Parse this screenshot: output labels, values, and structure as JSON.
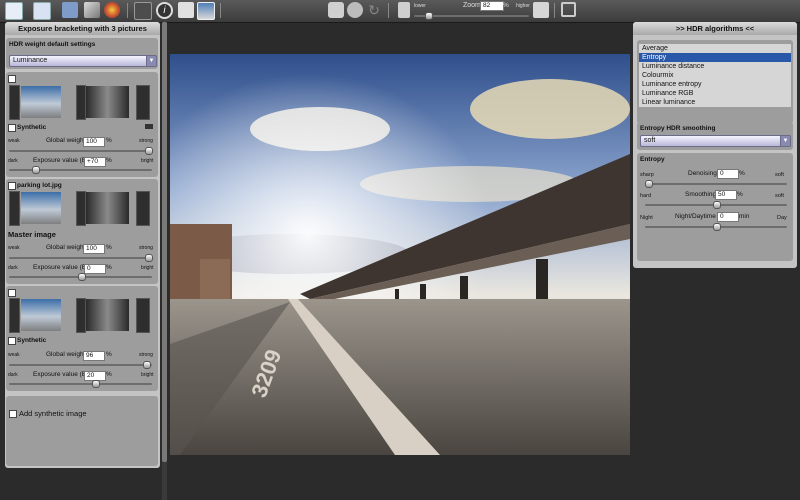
{
  "toolbar": {
    "zoom_label": "Zoom",
    "zoom_value": "82",
    "zoom_unit": "%",
    "lower_label": "lower",
    "higher_label": "higher",
    "zoom_level": 0.82
  },
  "left_panel": {
    "title": "Exposure bracketing with 3 pictures",
    "weight_default_label": "HDR weight default settings",
    "weight_mode": "Luminance",
    "images": [
      {
        "name": "Synthetic",
        "global_weight_label": "Global weight",
        "global_weight": "100",
        "percent": "%",
        "weak": "weak",
        "strong": "strong",
        "ev_label": "Exposure value (EV)",
        "ev": "+70",
        "dark": "dark",
        "bright": "bright",
        "weight_fraction": 1.0,
        "ev_fraction": 0.18
      },
      {
        "name": "parking lot.jpg",
        "master_label": "Master image",
        "global_weight_label": "Global weight",
        "global_weight": "100",
        "percent": "%",
        "weak": "weak",
        "strong": "strong",
        "ev_label": "Exposure value (EV)",
        "ev": "0",
        "dark": "dark",
        "bright": "bright",
        "weight_fraction": 1.0,
        "ev_fraction": 0.5
      },
      {
        "name": "Synthetic",
        "global_weight_label": "Global weight",
        "global_weight": "96",
        "percent": "%",
        "weak": "weak",
        "strong": "strong",
        "ev_label": "Exposure value (EV)",
        "ev": "20",
        "dark": "dark",
        "bright": "bright",
        "weight_fraction": 0.96,
        "ev_fraction": 0.6
      }
    ],
    "add_synthetic": "Add synthetic image"
  },
  "right_panel": {
    "title": ">> HDR algorithms <<",
    "algorithms": [
      "Average",
      "Entropy",
      "Luminance distance",
      "Colourmix",
      "Luminance entropy",
      "Luminance RGB",
      "Linear luminance"
    ],
    "selected": "Entropy",
    "smoothing_title": "Entropy HDR smoothing",
    "smoothing_value": "soft",
    "entropy_title": "Entropy",
    "denoising": {
      "label": "Denoising",
      "value": "0",
      "unit": "%",
      "left": "sharp",
      "right": "soft",
      "fraction": 0.0
    },
    "smoothing": {
      "label": "Smoothing",
      "value": "50",
      "unit": "%",
      "left": "hard",
      "right": "soft",
      "fraction": 0.5
    },
    "night_day": {
      "label": "Night/Daytime",
      "value": "0",
      "unit": "min",
      "left": "Night",
      "right": "Day",
      "fraction": 0.5
    }
  },
  "preview": {
    "painted_number": "3209"
  }
}
